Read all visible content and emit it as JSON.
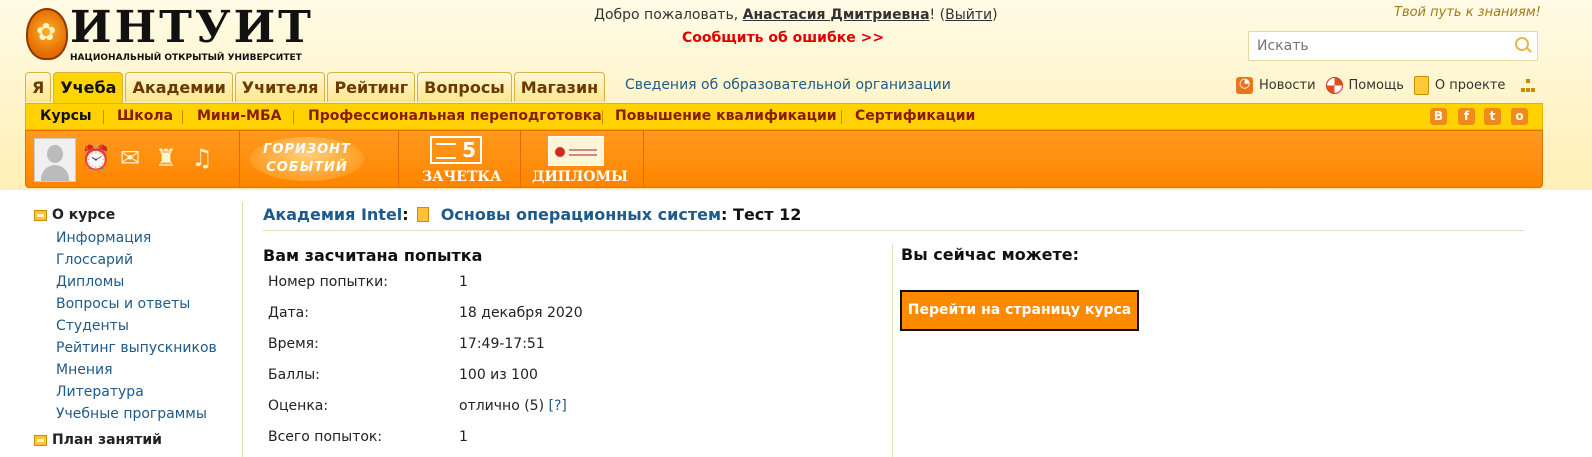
{
  "header": {
    "logo_word": "ИНТУИТ",
    "logo_subtitle": "НАЦИОНАЛЬНЫЙ ОТКРЫТЫЙ УНИВЕРСИТЕТ",
    "welcome_prefix": "Добро пожаловать,",
    "user_name": "Анастасия Дмитриевна",
    "welcome_excl": "!",
    "logout_open": "(",
    "logout_label": "Выйти",
    "logout_close": ")",
    "report_error": "Сообщить об ошибке >>",
    "slogan": "Твой путь к знаниям!",
    "search_placeholder": "Искать"
  },
  "main_tabs": [
    {
      "label": "Я",
      "active": false
    },
    {
      "label": "Учеба",
      "active": true
    },
    {
      "label": "Академии",
      "active": false
    },
    {
      "label": "Учителя",
      "active": false
    },
    {
      "label": "Рейтинг",
      "active": false
    },
    {
      "label": "Вопросы",
      "active": false
    },
    {
      "label": "Магазин",
      "active": false
    }
  ],
  "org_link": "Сведения об образовательной организации",
  "right_links": {
    "news": "Новости",
    "help": "Помощь",
    "about": "О проекте"
  },
  "subnav": [
    {
      "label": "Курсы",
      "active": true
    },
    {
      "label": "Школа",
      "active": false
    },
    {
      "label": "Мини-МБА",
      "active": false
    },
    {
      "label": "Профессиональная переподготовка",
      "active": false
    },
    {
      "label": "Повышение квалификации",
      "active": false
    },
    {
      "label": "Сертификации",
      "active": false
    }
  ],
  "social": [
    "В",
    "f",
    "t",
    "o"
  ],
  "toolbar": {
    "horizon_line1": "ГОРИЗОНТ",
    "horizon_line2": "СОБЫТИЙ",
    "zachetka_num": "5",
    "zachetka": "ЗАЧЕТКА",
    "diplomas": "ДИПЛОМЫ"
  },
  "sidebar": {
    "section1": "О курсе",
    "items": [
      "Информация",
      "Глоссарий",
      "Дипломы",
      "Вопросы и ответы",
      "Студенты",
      "Рейтинг выпускников",
      "Мнения",
      "Литература",
      "Учебные программы"
    ],
    "section2": "План занятий"
  },
  "breadcrumb": {
    "academy": "Академия Intel",
    "colon1": ":",
    "course": "Основы операционных систем",
    "colon2": ":",
    "test": "Тест 12"
  },
  "attempt": {
    "title": "Вам засчитана попытка",
    "rows": [
      {
        "key": "Номер попытки:",
        "value": "1"
      },
      {
        "key": "Дата:",
        "value": "18 декабря 2020"
      },
      {
        "key": "Время:",
        "value": "17:49-17:51"
      },
      {
        "key": "Баллы:",
        "value": "100 из 100"
      },
      {
        "key": "Оценка:",
        "value": "отлично (5)",
        "hint": "[?]"
      },
      {
        "key": "Всего попыток:",
        "value": "1"
      }
    ]
  },
  "actions": {
    "title": "Вы сейчас можете:",
    "go_course": "Перейти на страницу курса"
  }
}
